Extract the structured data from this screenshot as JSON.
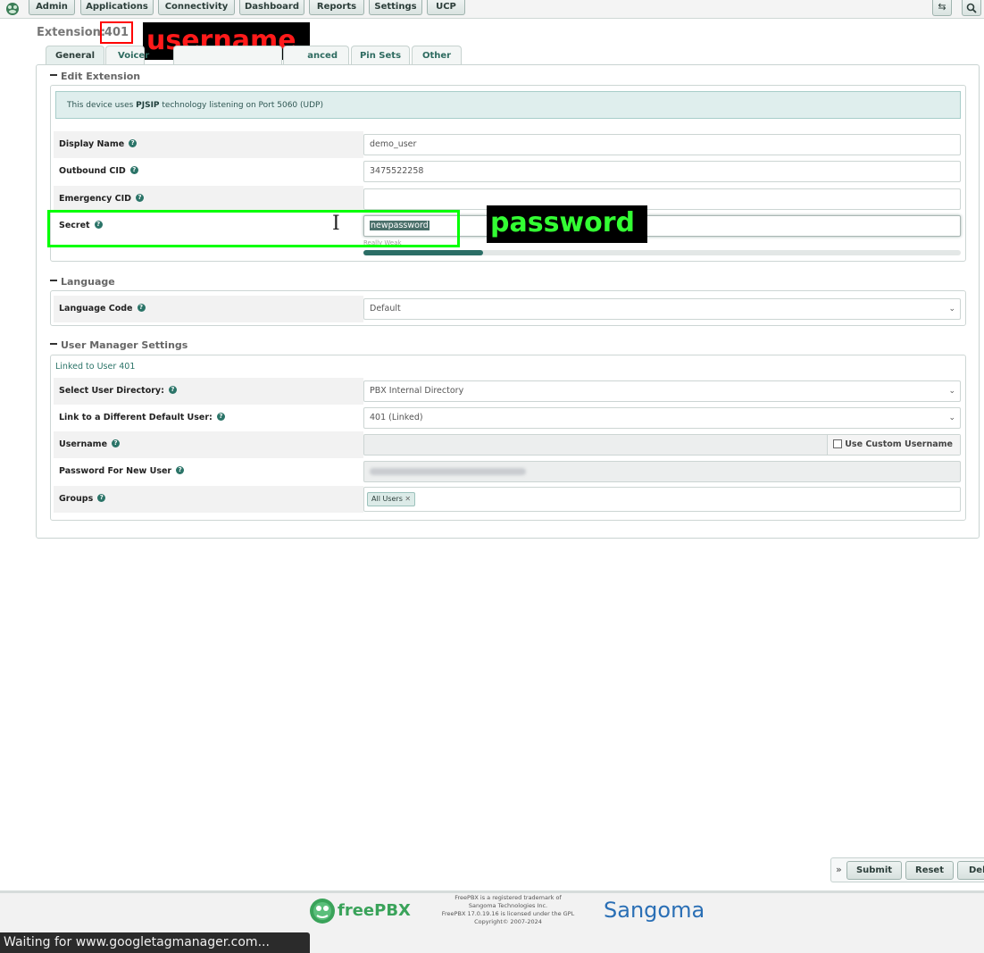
{
  "nav": {
    "items": [
      "Admin",
      "Applications",
      "Connectivity",
      "Dashboard",
      "Reports",
      "Settings",
      "UCP"
    ]
  },
  "header": {
    "label": "Extension:",
    "extension": "401",
    "annotation_username": "username"
  },
  "tabs": [
    "General",
    "Voicer",
    "anced",
    "Pin Sets",
    "Other"
  ],
  "edit_extension": {
    "title": "Edit Extension",
    "info_prefix": "This device uses ",
    "info_tech": "PJSIP",
    "info_suffix": " technology listening on Port 5060 (UDP)",
    "display_name_label": "Display Name",
    "display_name_value": "demo_user",
    "outbound_cid_label": "Outbound CID",
    "outbound_cid_value": "3475522258",
    "emergency_cid_label": "Emergency CID",
    "emergency_cid_value": "",
    "secret_label": "Secret",
    "secret_value": "newpassword",
    "strength_text": "Really Weak",
    "strength_fraction": 0.2,
    "annotation_password": "password"
  },
  "language": {
    "title": "Language",
    "code_label": "Language Code",
    "code_value": "Default"
  },
  "user_manager": {
    "title": "User Manager Settings",
    "linked_text": "Linked to User 401",
    "directory_label": "Select User Directory:",
    "directory_value": "PBX Internal Directory",
    "default_user_label": "Link to a Different Default User:",
    "default_user_value": "401 (Linked)",
    "username_label": "Username",
    "custom_username_label": "Use Custom Username",
    "password_label": "Password For New User",
    "groups_label": "Groups",
    "group_chip": "All Users"
  },
  "actions": {
    "expand": "»",
    "submit": "Submit",
    "reset": "Reset",
    "delete": "Del"
  },
  "footer": {
    "freepbx": "freePBX",
    "legal": [
      "FreePBX is a registered trademark of",
      "Sangoma Technologies Inc.",
      "FreePBX 17.0.19.16 is licensed under the GPL",
      "Copyright© 2007-2024"
    ],
    "sangoma": "Sangoma"
  },
  "status_text": "Waiting for www.googletagmanager.com..."
}
